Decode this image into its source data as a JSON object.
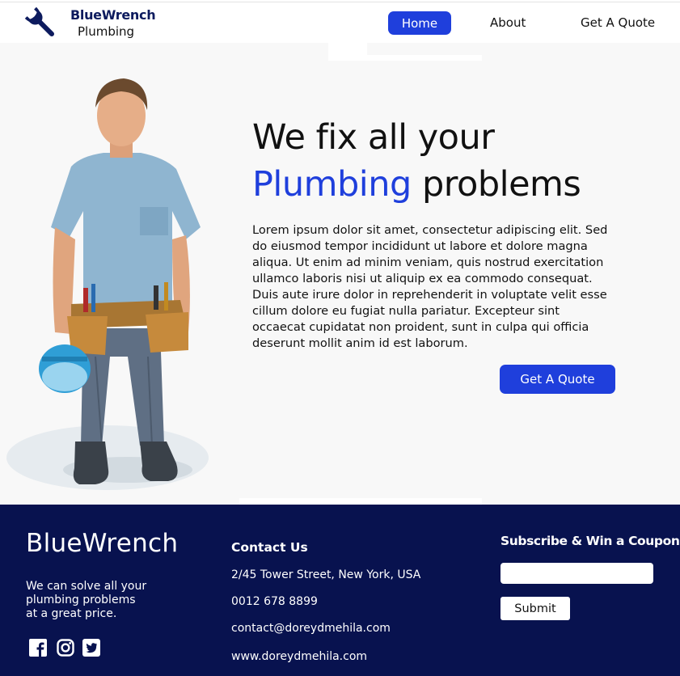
{
  "header": {
    "brand_line1": "BlueWrench",
    "brand_line2": "Plumbing",
    "logo_icon": "wrench-icon",
    "nav": {
      "home": "Home",
      "about": "About",
      "quote": "Get A Quote"
    }
  },
  "hero": {
    "headline_line1": "We fix all your",
    "headline_accent": "Plumbing",
    "headline_rest": "problems",
    "body": "Lorem ipsum dolor sit amet, consectetur adipiscing elit. Sed do eiusmod tempor incididunt ut labore et dolore magna aliqua. Ut enim ad minim veniam, quis nostrud exercitation ullamco laboris nisi ut aliquip ex ea commodo consequat. Duis aute irure dolor in reprehenderit in voluptate velit esse cillum dolore eu fugiat nulla pariatur. Excepteur sint occaecat cupidatat non proident, sunt in culpa qui officia deserunt mollit anim id est laborum.",
    "cta": "Get A Quote",
    "image": "plumber-with-tool-belt"
  },
  "footer": {
    "brand": "BlueWrench",
    "tagline_1": "We can solve all your",
    "tagline_2": "plumbing problems",
    "tagline_3": "at a great price.",
    "social_icons": [
      "facebook-icon",
      "instagram-icon",
      "twitter-icon"
    ],
    "contact": {
      "heading": "Contact Us",
      "address": "2/45 Tower Street, New York, USA",
      "phone": "0012 678 8899",
      "email": "contact@doreydmehila.com",
      "website": "www.doreydmehila.com"
    },
    "subscribe": {
      "heading": "Subscribe & Win a Coupon",
      "input_value": "",
      "submit": "Submit"
    }
  },
  "colors": {
    "accent_blue": "#1f3fdc",
    "footer_navy": "#08124f",
    "hero_bg": "#f8f8f8",
    "brand_navy": "#0d1b5e"
  }
}
